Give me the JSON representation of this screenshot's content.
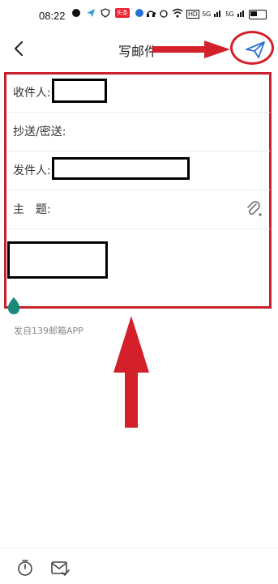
{
  "status_bar": {
    "time": "08:22",
    "network_badge": "",
    "signal_labels": [
      "HD",
      "5G",
      "5G"
    ],
    "battery_level": 0.4
  },
  "nav": {
    "title": "写邮件",
    "back_icon": "chevron-left-icon",
    "send_icon": "paper-plane-icon"
  },
  "compose": {
    "to_label": "收件人:",
    "cc_label": "抄送/密送:",
    "from_label": "发件人:",
    "subject_label": "主　题:",
    "attachment_icon": "paperclip-plus-icon"
  },
  "signature": "发自139邮箱APP",
  "bottom_bar": {
    "timer_icon": "timer-icon",
    "receipt_icon": "envelope-check-icon"
  },
  "colors": {
    "annotation_red": "#d4202a",
    "accent_blue": "#2a6fd8"
  }
}
